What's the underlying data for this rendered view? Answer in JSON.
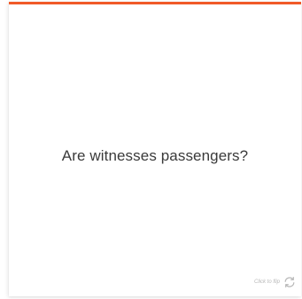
{
  "flashcard": {
    "question": "Are witnesses passengers?",
    "flip_hint": "Click to flip",
    "accent_color": "#f05a28",
    "flip_icon": "refresh-icon"
  }
}
